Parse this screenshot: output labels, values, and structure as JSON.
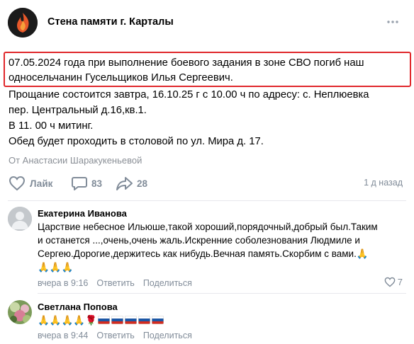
{
  "group": {
    "name": "Стена памяти г. Карталы"
  },
  "post": {
    "highlighted_lines": [
      "07.05.2024 года при выполнение боевого задания в зоне СВО погиб наш",
      "односельчанин Гусельщиков Илья Сергеевич."
    ],
    "lines": [
      "Прощание состоится завтра, 16.10.25 г с 10.00 ч по адресу: с. Неплюевка",
      "пер. Центральный д.16,кв.1.",
      "В 11. 00 ч митинг.",
      "Обед будет проходить в столовой по ул. Мира д. 17."
    ],
    "author": "От Анастасии Шаракукеньевой",
    "like_label": "Лайк",
    "comments_count": "83",
    "reposts_count": "28",
    "time_ago": "1 д назад"
  },
  "comments": [
    {
      "author": "Екатерина Иванова",
      "lines": [
        "Царствие небесное Ильюше,такой хороший,порядочный,добрый был.Таким",
        "и останется ...,очень,очень жаль.Искренние соболезнования Людмиле и",
        "Сергею.Дорогие,держитесь как нибудь.Вечная память.Скорбим с вами."
      ],
      "emoji_line": "🙏🙏🙏",
      "trailing_emoji": "🙏",
      "time": "вчера в 9:16",
      "reply_label": "Ответить",
      "share_label": "Поделиться",
      "likes": "7",
      "avatar_color": "#b0b5bb"
    },
    {
      "author": "Светлана Попова",
      "emoji_line": "🙏🙏🙏🙏🌹",
      "flags_count_note": "",
      "time": "вчера в 9:44",
      "reply_label": "Ответить",
      "share_label": "Поделиться",
      "avatar_color": "#6c8f4e"
    }
  ],
  "icons": {
    "more": "more-dots-icon",
    "like": "heart-icon",
    "comment": "comment-icon",
    "share": "share-arrow-icon"
  },
  "colors": {
    "highlight_border": "#e0272b",
    "muted_text": "#818c99"
  }
}
